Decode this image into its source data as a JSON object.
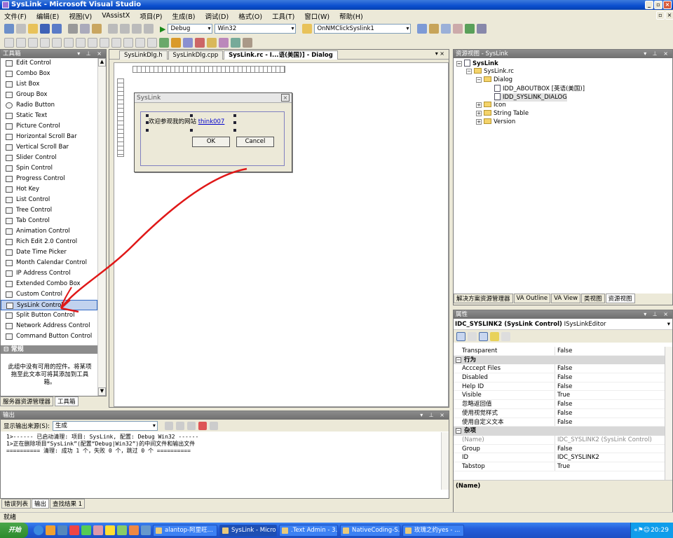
{
  "window": {
    "title": "SysLink - Microsoft Visual Studio"
  },
  "menu": [
    "文件(F)",
    "编辑(E)",
    "视图(V)",
    "VAssistX",
    "项目(P)",
    "生成(B)",
    "调试(D)",
    "格式(O)",
    "工具(T)",
    "窗口(W)",
    "帮助(H)"
  ],
  "toolbar": {
    "config": "Debug",
    "platform": "Win32",
    "find": "OnNMClickSyslink1"
  },
  "toolbox": {
    "title": "工具箱",
    "items": [
      "Edit Control",
      "Combo Box",
      "List Box",
      "Group Box",
      "Radio Button",
      "Static Text",
      "Picture Control",
      "Horizontal Scroll Bar",
      "Vertical Scroll Bar",
      "Slider Control",
      "Spin Control",
      "Progress Control",
      "Hot Key",
      "List Control",
      "Tree Control",
      "Tab Control",
      "Animation Control",
      "Rich Edit 2.0 Control",
      "Date Time Picker",
      "Month Calendar Control",
      "IP Address Control",
      "Extended Combo Box",
      "Custom Control",
      "SysLink Control",
      "Split Button Control",
      "Network Address Control",
      "Command Button Control"
    ],
    "selected": "SysLink Control",
    "group": "常规",
    "empty_msg": "此组中没有可用的控件。将某项拖至此文本可将其添加到工具箱。",
    "tabs": [
      "服务器资源管理器",
      "工具箱"
    ]
  },
  "editor": {
    "tabs": [
      "SysLinkDlg.h",
      "SysLinkDlg.cpp",
      "SysLink.rc - I...语(美国)] - Dialog"
    ],
    "dialog": {
      "title": "SysLink",
      "static_text": "欢迎参观我的网站",
      "link_text": "think007",
      "ok": "OK",
      "cancel": "Cancel"
    }
  },
  "resource_view": {
    "title": "资源视图 - SysLink",
    "tree": {
      "root": "SysLink",
      "rc": "SysLink.rc",
      "dialog_folder": "Dialog",
      "dialogs": [
        "IDD_ABOUTBOX [英语(美国)]",
        "IDD_SYSLINK_DIALOG"
      ],
      "folders": [
        "Icon",
        "String Table",
        "Version"
      ]
    },
    "tabs": [
      "解决方案资源管理器",
      "VA Outline",
      "VA View",
      "类视图",
      "资源视图"
    ]
  },
  "properties": {
    "title": "属性",
    "object": "IDC_SYSLINK2 (SysLink Control)",
    "object_type": "ISysLinkEditor",
    "rows_top": [
      {
        "name": "Transparent",
        "value": "False"
      }
    ],
    "cat_behavior": "行为",
    "behavior": [
      {
        "name": "Acccept Files",
        "value": "False"
      },
      {
        "name": "Disabled",
        "value": "False"
      },
      {
        "name": "Help ID",
        "value": "False"
      },
      {
        "name": "Visible",
        "value": "True"
      },
      {
        "name": "忽略返回值",
        "value": "False"
      },
      {
        "name": "使用视觉样式",
        "value": "False"
      },
      {
        "name": "使用自定义文本",
        "value": "False"
      }
    ],
    "cat_misc": "杂项",
    "misc": [
      {
        "name": "(Name)",
        "value": "IDC_SYSLINK2 (SysLink Control)"
      },
      {
        "name": "Group",
        "value": "False"
      },
      {
        "name": "ID",
        "value": "IDC_SYSLINK2"
      },
      {
        "name": "Tabstop",
        "value": "True"
      }
    ],
    "desc": "(Name)"
  },
  "output": {
    "title": "输出",
    "source_label": "显示输出来源(S):",
    "source_value": "生成",
    "lines": [
      "1>------ 已启动清理: 项目: SysLink, 配置: Debug Win32 ------",
      "1>正在删除项目“SysLink”(配置“Debug|Win32”)的中间文件和输出文件",
      "========== 清理: 成功 1 个，失败 0 个，跳过 0 个 =========="
    ],
    "tabs": [
      "错误列表",
      "输出",
      "查找结果 1"
    ]
  },
  "status": "就绪",
  "taskbar": {
    "start": "开始",
    "tasks": [
      "alantop-阿里旺...",
      "SysLink - Micros...",
      ".Text Admin - 3...",
      "NativeCoding-S...",
      "玫瑰之约yes - ..."
    ],
    "clock": "20:29"
  }
}
